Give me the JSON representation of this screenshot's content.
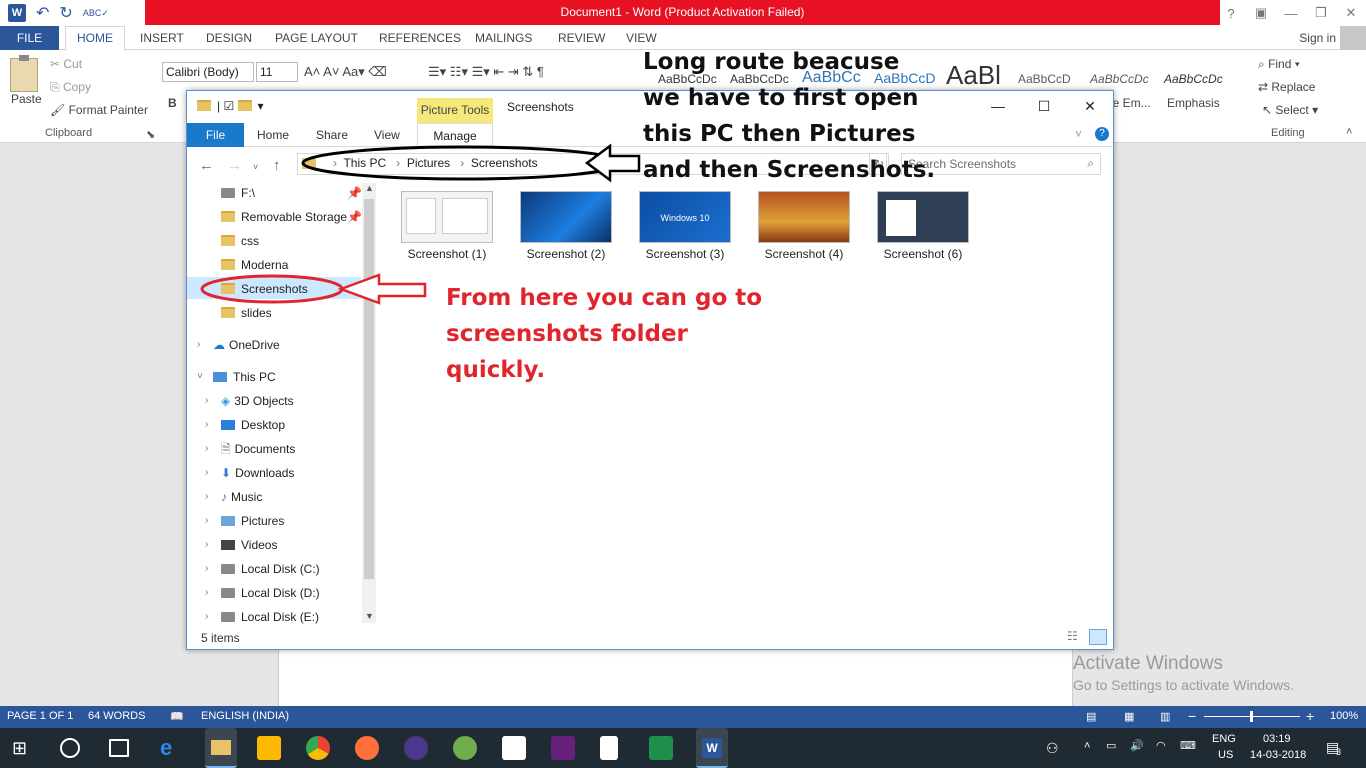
{
  "word": {
    "title": "Document1 -  Word (Product Activation Failed)",
    "tabs": [
      "FILE",
      "HOME",
      "INSERT",
      "DESIGN",
      "PAGE LAYOUT",
      "REFERENCES",
      "MAILINGS",
      "REVIEW",
      "VIEW"
    ],
    "sign_in": "Sign in",
    "clipboard": {
      "paste": "Paste",
      "cut": "Cut",
      "copy": "Copy",
      "format_painter": "Format Painter",
      "label": "Clipboard"
    },
    "font": {
      "name": "Calibri (Body)",
      "size": "11"
    },
    "styles": [
      "AaBbCcDc",
      "AaBbCcDc",
      "AaBbCc",
      "AaBbCcD",
      "AaBl",
      "AaBbCcD",
      "AaBbCcDc",
      "AaBbCcDc"
    ],
    "style_names": [
      "le Em...",
      "Emphasis"
    ],
    "editing": {
      "find": "Find",
      "replace": "Replace",
      "select": "Select",
      "label": "Editing"
    }
  },
  "explorer": {
    "picture_tools": "Picture Tools",
    "title": "Screenshots",
    "tabs": {
      "file": "File",
      "home": "Home",
      "share": "Share",
      "view": "View",
      "manage": "Manage"
    },
    "breadcrumb": [
      "This PC",
      "Pictures",
      "Screenshots"
    ],
    "search_placeholder": "Search Screenshots",
    "sidebar": {
      "f_drive": "F:\\",
      "removable": "Removable Storage",
      "css": "css",
      "moderna": "Moderna",
      "screenshots": "Screenshots",
      "slides": "slides",
      "onedrive": "OneDrive",
      "this_pc": "This PC",
      "objects": "3D Objects",
      "desktop": "Desktop",
      "documents": "Documents",
      "downloads": "Downloads",
      "music": "Music",
      "pictures": "Pictures",
      "videos": "Videos",
      "c": "Local Disk (C:)",
      "d": "Local Disk (D:)",
      "e": "Local Disk (E:)"
    },
    "files": [
      "Screenshot (1)",
      "Screenshot (2)",
      "Screenshot (3)",
      "Screenshot (4)",
      "Screenshot (6)"
    ],
    "thumb3_text": "Windows 10",
    "status": "5 items"
  },
  "annotations": {
    "long_route": "Long route beacuse we have to first open this PC then Pictures and then Screenshots.",
    "quick": "From here you can go to screenshots folder quickly."
  },
  "watermark": {
    "line1": "Activate Windows",
    "line2": "Go to Settings to activate Windows."
  },
  "statusbar": {
    "page": "PAGE 1 OF 1",
    "words": "64 WORDS",
    "language": "ENGLISH (INDIA)",
    "zoom": "100%"
  },
  "taskbar": {
    "lang1": "ENG",
    "lang2": "US",
    "time": "03:19",
    "date": "14-03-2018",
    "notif_count": "3"
  },
  "colors": {
    "word_blue": "#2b579a",
    "title_red": "#e81123",
    "annot_red": "#e0262c",
    "picture_tools": "#f7e87c"
  }
}
